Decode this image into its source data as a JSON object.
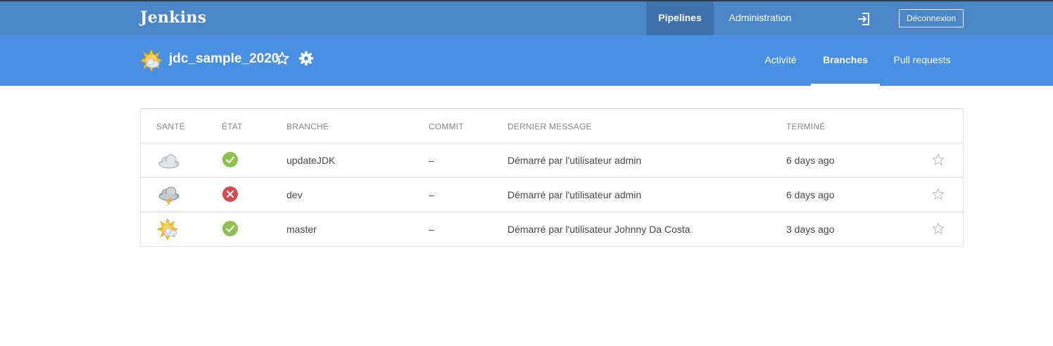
{
  "topbar": {
    "logo": "Jenkins",
    "nav": {
      "pipelines": "Pipelines",
      "administration": "Administration"
    },
    "logout": "Déconnexion",
    "exit_icon": "sign-in-icon"
  },
  "subheader": {
    "pipeline_name": "jdc_sample_2020",
    "tabs": {
      "activity": "Activité",
      "branches": "Branches",
      "pull_requests": "Pull requests"
    },
    "active_tab": "Branches"
  },
  "table": {
    "headers": {
      "health": "SANTÉ",
      "status": "ÉTAT",
      "branch": "BRANCHE",
      "commit": "COMMIT",
      "message": "DERNIER MESSAGE",
      "finished": "TERMINÉ"
    },
    "rows": [
      {
        "health": "cloudy-icon",
        "status": "success",
        "branch": "updateJDK",
        "commit": "–",
        "message": "Démarré par l'utilisateur admin",
        "finished": "6 days ago"
      },
      {
        "health": "storm-icon",
        "status": "failure",
        "branch": "dev",
        "commit": "–",
        "message": "Démarré par l'utilisateur admin",
        "finished": "6 days ago"
      },
      {
        "health": "sunny-icon",
        "status": "success",
        "branch": "master",
        "commit": "–",
        "message": "Démarré par l'utilisateur Johnny Da Costa",
        "finished": "3 days ago"
      }
    ]
  },
  "colors": {
    "topbar": "#4a86c8",
    "subheader": "#4a90e2",
    "success": "#8cc04f",
    "failure": "#d54c53"
  }
}
